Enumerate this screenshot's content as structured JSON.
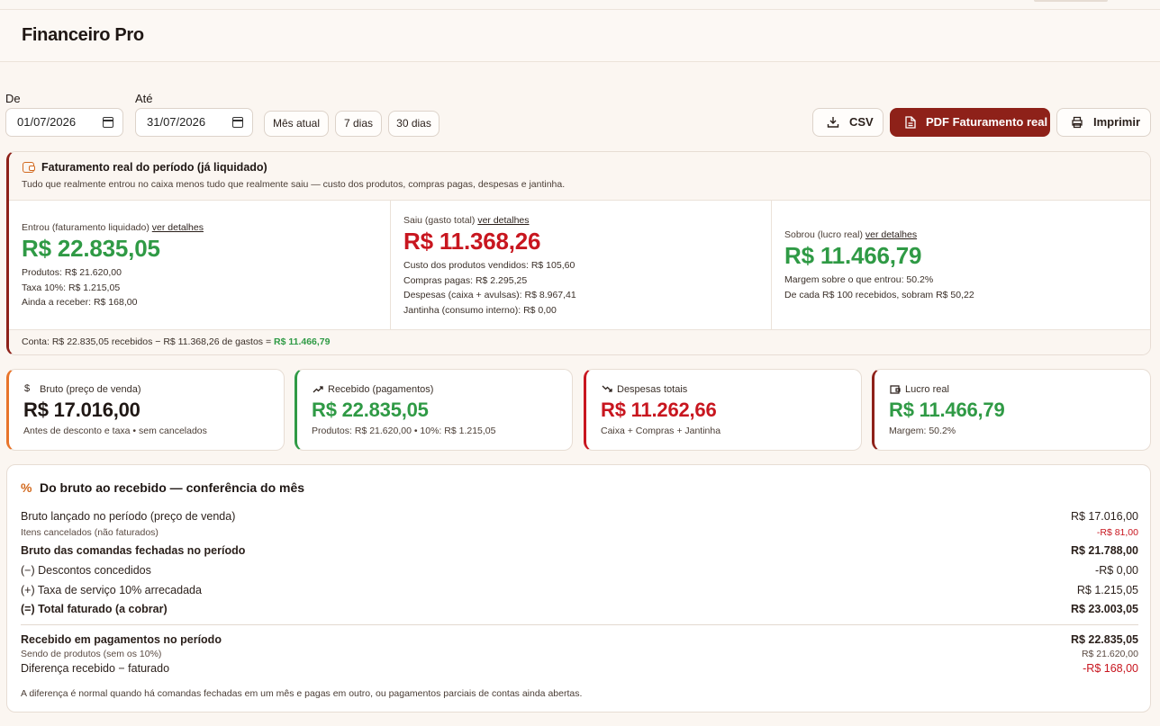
{
  "app": {
    "title": "Financeiro Pro"
  },
  "filters": {
    "from_label": "De",
    "from_value": "01/07/2026",
    "to_label": "Até",
    "to_value": "31/07/2026",
    "presets": [
      "Mês atual",
      "7 dias",
      "30 dias"
    ]
  },
  "actions": {
    "csv": "CSV",
    "pdf": "PDF Faturamento real",
    "print": "Imprimir"
  },
  "summary": {
    "title": "Faturamento real do período (já liquidado)",
    "subtitle": "Tudo que realmente entrou no caixa menos tudo que realmente saiu — custo dos produtos, compras pagas, despesas e jantinha.",
    "details_link": "ver detalhes",
    "entrou": {
      "label": "Entrou (faturamento liquidado)",
      "value": "R$ 22.835,05",
      "lines": [
        "Produtos: R$ 21.620,00",
        "Taxa 10%: R$ 1.215,05",
        "Ainda a receber: R$ 168,00"
      ]
    },
    "saiu": {
      "label": "Saiu (gasto total)",
      "value": "R$ 11.368,26",
      "lines": [
        "Custo dos produtos vendidos: R$ 105,60",
        "Compras pagas: R$ 2.295,25",
        "Despesas (caixa + avulsas): R$ 8.967,41",
        "Jantinha (consumo interno): R$ 0,00"
      ]
    },
    "sobrou": {
      "label": "Sobrou (lucro real)",
      "value": "R$ 11.466,79",
      "lines": [
        "Margem sobre o que entrou: 50.2%",
        "De cada R$ 100 recebidos, sobram R$ 50,22"
      ]
    },
    "footer_text": "Conta: R$ 22.835,05 recebidos − R$ 11.368,26 de gastos = ",
    "footer_result": "R$ 11.466,79"
  },
  "kpis": [
    {
      "label": "Bruto (preço de venda)",
      "value": "R$ 17.016,00",
      "sub": "Antes de desconto e taxa • sem cancelados",
      "icon": "dollar-icon",
      "accent": "#e8742a"
    },
    {
      "label": "Recebido (pagamentos)",
      "value": "R$ 22.835,05",
      "sub": "Produtos: R$ 21.620,00 • 10%: R$ 1.215,05",
      "icon": "trend-up-icon",
      "accent": "#2f9a45"
    },
    {
      "label": "Despesas totais",
      "value": "R$ 11.262,66",
      "sub": "Caixa + Compras + Jantinha",
      "icon": "trend-down-icon",
      "accent": "#c8161f"
    },
    {
      "label": "Lucro real",
      "value": "R$ 11.466,79",
      "sub": "Margem: 50.2%",
      "icon": "wallet-icon",
      "accent": "#8e2119"
    }
  ],
  "conference": {
    "title": "Do bruto ao recebido — conferência do mês",
    "rows": [
      {
        "label": "Bruto lançado no período (preço de venda)",
        "value": "R$ 17.016,00"
      },
      {
        "label": "Itens cancelados (não faturados)",
        "value": "-R$ 81,00"
      },
      {
        "label": "Bruto das comandas fechadas no período",
        "value": "R$ 21.788,00"
      },
      {
        "label": "(−) Descontos concedidos",
        "value": "-R$ 0,00"
      },
      {
        "label": "(+) Taxa de serviço 10% arrecadada",
        "value": "R$ 1.215,05"
      },
      {
        "label": "(=) Total faturado (a cobrar)",
        "value": "R$ 23.003,05"
      },
      {
        "label": "Recebido em pagamentos no período",
        "value": "R$ 22.835,05"
      },
      {
        "label": "Sendo de produtos (sem os 10%)",
        "value": "R$ 21.620,00"
      },
      {
        "label": "Diferença recebido − faturado",
        "value": "-R$ 168,00"
      }
    ],
    "note": "A diferença é normal quando há comandas fechadas em um mês e pagas em outro, ou pagamentos parciais de contas ainda abertas."
  }
}
